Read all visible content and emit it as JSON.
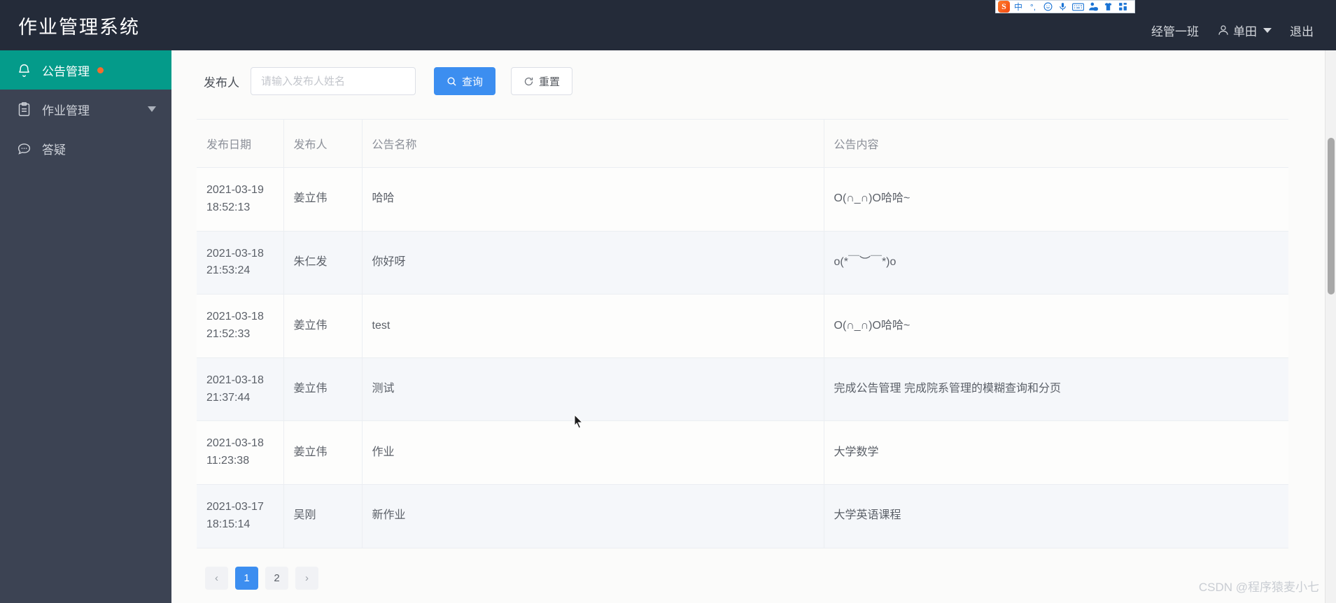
{
  "header": {
    "brand": "作业管理系统",
    "class_name": "经管一班",
    "user_name": "单田",
    "user_icon": "user-outline-icon",
    "caret_icon": "chevron-down-icon",
    "logout_label": "退出"
  },
  "ime_toolbar": {
    "logo": "S",
    "items": [
      {
        "name": "language-mode",
        "glyph": "中"
      },
      {
        "name": "punctuation-mode",
        "glyph": "°,"
      },
      {
        "name": "emoji-panel",
        "glyph": "☺"
      },
      {
        "name": "voice-input",
        "glyph": "mic-icon"
      },
      {
        "name": "soft-keyboard",
        "glyph": "keyboard-icon"
      },
      {
        "name": "user-center",
        "glyph": "user-badge-icon"
      },
      {
        "name": "skin-center",
        "glyph": "shirt-icon"
      },
      {
        "name": "toolbox",
        "glyph": "grid-icon"
      }
    ]
  },
  "sidebar": {
    "items": [
      {
        "label": "公告管理",
        "icon": "bell-icon",
        "active": true,
        "badge_dot": true,
        "has_caret": false
      },
      {
        "label": "作业管理",
        "icon": "clipboard-icon",
        "active": false,
        "badge_dot": false,
        "has_caret": true
      },
      {
        "label": "答疑",
        "icon": "chat-icon",
        "active": false,
        "badge_dot": false,
        "has_caret": false
      }
    ]
  },
  "filter": {
    "label": "发布人",
    "input_value": "",
    "input_placeholder": "请输入发布人姓名",
    "search_button": {
      "label": "查询",
      "icon": "search-icon"
    },
    "reset_button": {
      "label": "重置",
      "icon": "refresh-icon"
    }
  },
  "table": {
    "columns": [
      "发布日期",
      "发布人",
      "公告名称",
      "公告内容"
    ],
    "rows": [
      {
        "date": "2021-03-19\n18:52:13",
        "author": "姜立伟",
        "title": "哈哈",
        "content": "O(∩_∩)O哈哈~"
      },
      {
        "date": "2021-03-18\n21:53:24",
        "author": "朱仁发",
        "title": "你好呀",
        "content": "o(*￣︶￣*)o"
      },
      {
        "date": "2021-03-18\n21:52:33",
        "author": "姜立伟",
        "title": "test",
        "content": "O(∩_∩)O哈哈~"
      },
      {
        "date": "2021-03-18\n21:37:44",
        "author": "姜立伟",
        "title": "测试",
        "content": "完成公告管理 完成院系管理的模糊查询和分页"
      },
      {
        "date": "2021-03-18\n11:23:38",
        "author": "姜立伟",
        "title": "作业",
        "content": "大学数学"
      },
      {
        "date": "2021-03-17\n18:15:14",
        "author": "吴刚",
        "title": "新作业",
        "content": "大学英语课程"
      }
    ]
  },
  "pagination": {
    "prev_label": "‹",
    "next_label": "›",
    "pages": [
      "1",
      "2"
    ],
    "current": "1"
  },
  "watermark": "CSDN @程序猿麦小七",
  "colors": {
    "header_bg": "#242b39",
    "sidebar_bg": "#3c4353",
    "active_menu": "#049b8a",
    "primary": "#3c8ef0",
    "badge": "#f56c2d"
  }
}
